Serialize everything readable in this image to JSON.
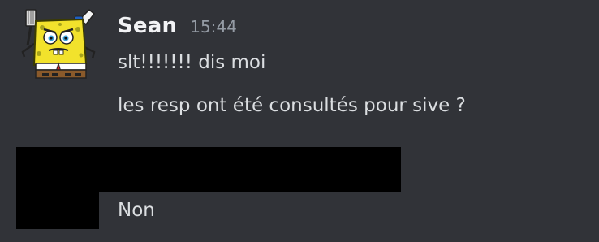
{
  "message_group": {
    "author": {
      "username": "Sean",
      "timestamp": "15:44",
      "avatar_icon": "spongebob-spatula-avatar-icon"
    },
    "messages": [
      {
        "text": "slt!!!!!!! dis moi"
      },
      {
        "text": "les resp ont été consultés pour sive ?"
      }
    ]
  },
  "reply_group": {
    "messages": [
      {
        "text": "Non"
      }
    ]
  },
  "colors": {
    "background": "#313338",
    "username": "#f2f3f5",
    "timestamp": "#949ba4",
    "message_text": "#dbdee1",
    "redaction": "#000000"
  }
}
